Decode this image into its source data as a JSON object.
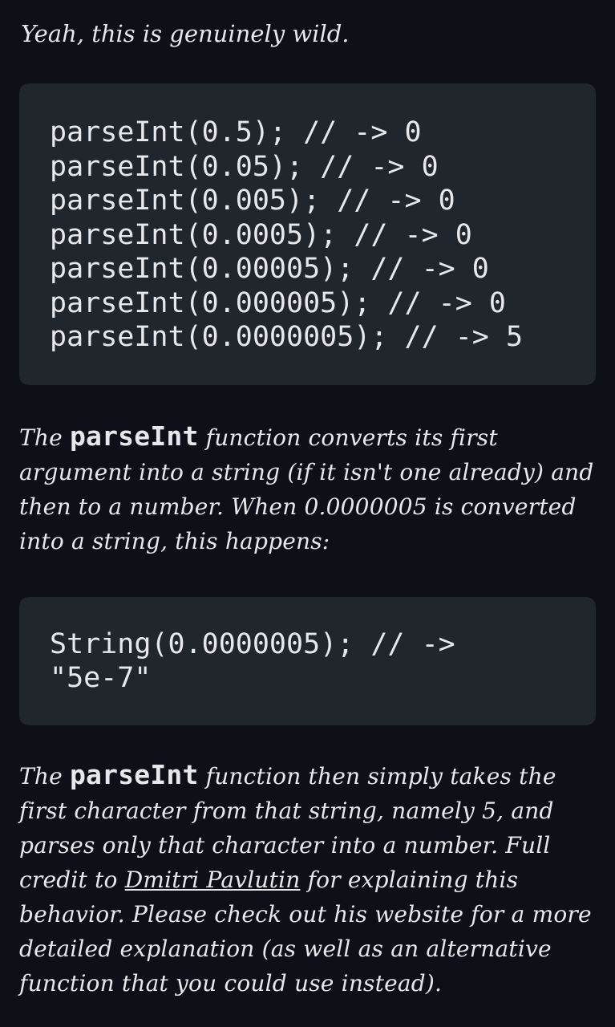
{
  "intro": "Yeah, this is genuinely wild.",
  "code_block_1": {
    "lines": [
      "parseInt(0.5); // -> 0",
      "parseInt(0.05); // -> 0",
      "parseInt(0.005); // -> 0",
      "parseInt(0.0005); // -> 0",
      "parseInt(0.00005); // -> 0",
      "parseInt(0.000005); // -> 0",
      "parseInt(0.0000005); // -> 5"
    ]
  },
  "paragraph_1": {
    "part1": "The ",
    "code": "parseInt",
    "part2": " function converts its first argument into a string (if it isn't one already) and then to a number. When 0.0000005 is converted into a string, this happens:"
  },
  "code_block_2": {
    "text": "String(0.0000005); // -> \"5e-7\""
  },
  "paragraph_2": {
    "part1": "The ",
    "code": "parseInt",
    "part2": " function then simply takes the first character from that string, namely 5, and parses only that character into a number. Full credit to ",
    "link": "Dmitri Pavlutin",
    "part3": " for explaining this behavior. Please check out his website for a more detailed explanation (as well as an alternative function that you could use instead)."
  }
}
